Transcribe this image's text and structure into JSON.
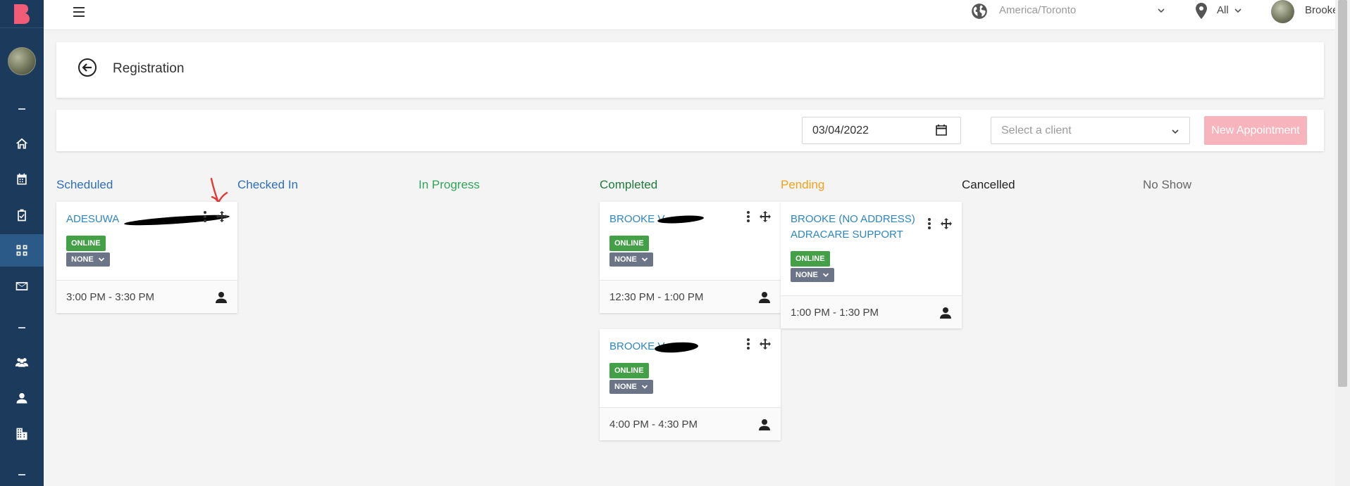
{
  "sidebar": {
    "logo_letter": "B",
    "items": [
      {
        "icon": "home-icon"
      },
      {
        "icon": "calendar-icon"
      },
      {
        "icon": "checklist-icon"
      },
      {
        "icon": "grid-icon",
        "active": true
      },
      {
        "icon": "mail-icon"
      },
      {
        "icon": "users-icon"
      },
      {
        "icon": "user-icon"
      },
      {
        "icon": "building-icon"
      }
    ]
  },
  "topbar": {
    "timezone": "America/Toronto",
    "location": "All",
    "user_name": "Brooke"
  },
  "header": {
    "title": "Registration"
  },
  "filters": {
    "date": "03/04/2022",
    "client_placeholder": "Select a client",
    "new_appointment_label": "New Appointment"
  },
  "columns": [
    {
      "label": "Scheduled",
      "color": "#2e6fb7"
    },
    {
      "label": "Checked In",
      "color": "#2e6fb7"
    },
    {
      "label": "In Progress",
      "color": "#2fa55a"
    },
    {
      "label": "Completed",
      "color": "#1e7a3c"
    },
    {
      "label": "Pending",
      "color": "#f0a21b"
    },
    {
      "label": "Cancelled",
      "color": "#222222"
    },
    {
      "label": "No Show",
      "color": "#666666"
    }
  ],
  "cards": {
    "scheduled_1": {
      "name": "ADESUWA",
      "badge": "ONLINE",
      "status": "NONE",
      "time": "3:00 PM - 3:30 PM"
    },
    "completed_1": {
      "name": "BROOKE V",
      "badge": "ONLINE",
      "status": "NONE",
      "time": "12:30 PM - 1:00 PM"
    },
    "completed_2": {
      "name": "BROOKE V",
      "badge": "ONLINE",
      "status": "NONE",
      "time": "4:00 PM - 4:30 PM"
    },
    "pending_1": {
      "name": "BROOKE (NO ADDRESS) ADRACARE SUPPORT",
      "badge": "ONLINE",
      "status": "NONE",
      "time": "1:00 PM - 1:30 PM"
    }
  },
  "colors": {
    "sidebar_bg": "#1b3a5c",
    "sidebar_active": "#2c5a88",
    "accent_pink": "#f8b4bd",
    "online_green": "#43a047",
    "none_gray": "#6c7587",
    "link_blue": "#2e86c1"
  }
}
